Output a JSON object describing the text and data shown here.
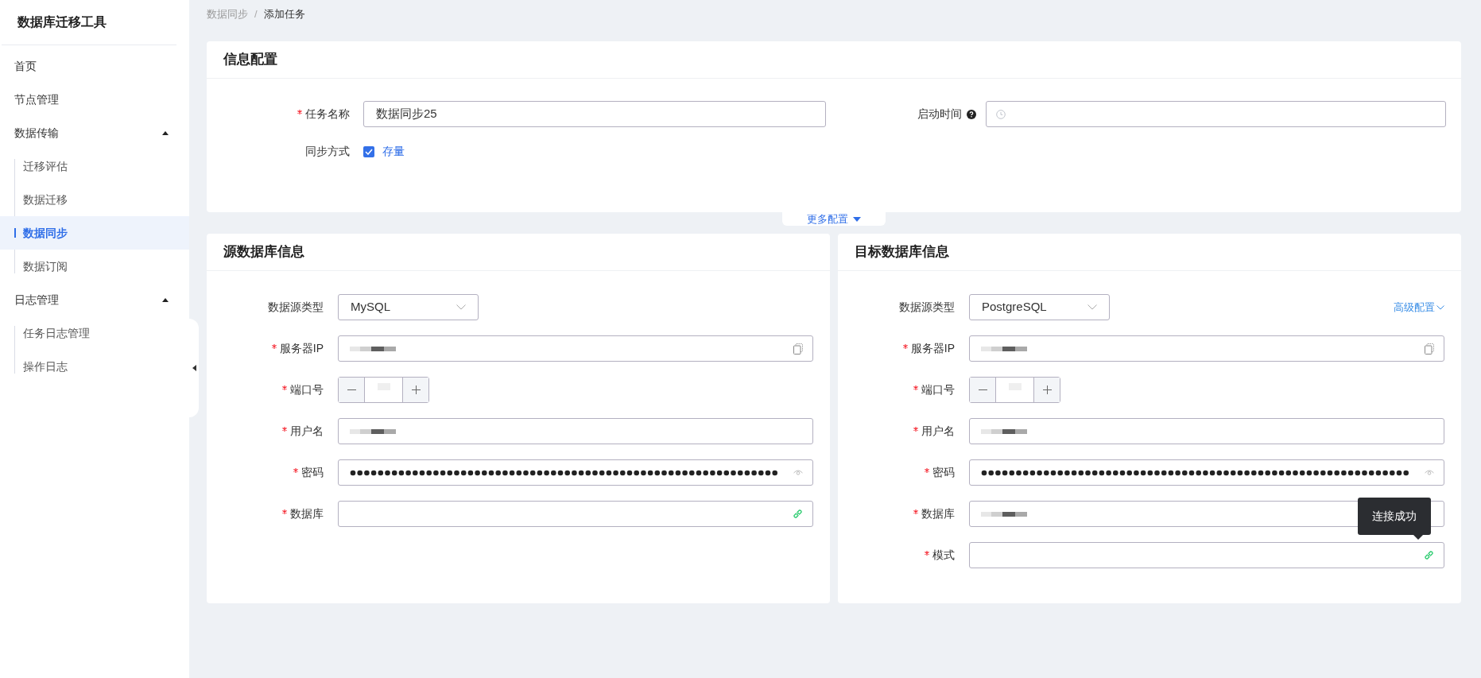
{
  "sidebar": {
    "title": "数据库迁移工具",
    "items": [
      {
        "label": "首页",
        "selected": false
      },
      {
        "label": "节点管理",
        "selected": false
      },
      {
        "label": "数据传输",
        "selected": false,
        "expanded": true,
        "children": [
          {
            "label": "迁移评估",
            "selected": false
          },
          {
            "label": "数据迁移",
            "selected": false
          },
          {
            "label": "数据同步",
            "selected": true
          },
          {
            "label": "数据订阅",
            "selected": false
          }
        ]
      },
      {
        "label": "日志管理",
        "selected": false,
        "expanded": true,
        "children": [
          {
            "label": "任务日志管理",
            "selected": false
          },
          {
            "label": "操作日志",
            "selected": false
          }
        ]
      }
    ]
  },
  "breadcrumb": {
    "separator": "/",
    "items": [
      "数据同步",
      "添加任务"
    ]
  },
  "info_config": {
    "title": "信息配置",
    "task_name": {
      "label": "任务名称",
      "required": true,
      "value": "数据同步25"
    },
    "start_time": {
      "label": "启动时间",
      "required": false
    },
    "sync_mode": {
      "label": "同步方式",
      "option": "存量",
      "checked": true
    },
    "more_toggle": "更多配置"
  },
  "panels": [
    {
      "title": "源数据库信息",
      "fields": [
        {
          "kind": "select",
          "label": "数据源类型",
          "required": false,
          "value": "MySQL"
        },
        {
          "kind": "ip",
          "label": "服务器IP",
          "required": true,
          "redacted": true
        },
        {
          "kind": "port",
          "label": "端口号",
          "required": true,
          "redacted": true
        },
        {
          "kind": "text",
          "label": "用户名",
          "required": true,
          "redacted": true
        },
        {
          "kind": "password",
          "label": "密码",
          "required": true
        },
        {
          "kind": "link",
          "label": "数据库",
          "required": true,
          "redacted": false
        }
      ]
    },
    {
      "title": "目标数据库信息",
      "advanced_link": "高级配置",
      "fields": [
        {
          "kind": "select",
          "label": "数据源类型",
          "required": false,
          "value": "PostgreSQL"
        },
        {
          "kind": "ip",
          "label": "服务器IP",
          "required": true,
          "redacted": true
        },
        {
          "kind": "port",
          "label": "端口号",
          "required": true,
          "redacted": true
        },
        {
          "kind": "text",
          "label": "用户名",
          "required": true,
          "redacted": true
        },
        {
          "kind": "password",
          "label": "密码",
          "required": true
        },
        {
          "kind": "text",
          "label": "数据库",
          "required": true,
          "redacted": true
        },
        {
          "kind": "link",
          "label": "模式",
          "required": true,
          "redacted": false,
          "tooltip": "连接成功"
        }
      ]
    }
  ]
}
